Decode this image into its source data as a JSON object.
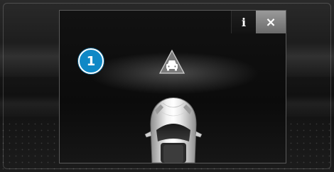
{
  "screen": {
    "marker": {
      "number": "1",
      "color": "#0f88c6"
    }
  },
  "panel": {
    "buttons": {
      "info": {
        "label": "i",
        "icon": "info-icon"
      },
      "close": {
        "label": "×",
        "icon": "close-icon"
      }
    },
    "warning": {
      "icon": "vehicle-ahead-warning-icon"
    },
    "vehicle": {
      "icon": "ego-car-top-view"
    }
  },
  "colors": {
    "accent": "#0f88c6",
    "close_button": "#8a8a8a"
  }
}
